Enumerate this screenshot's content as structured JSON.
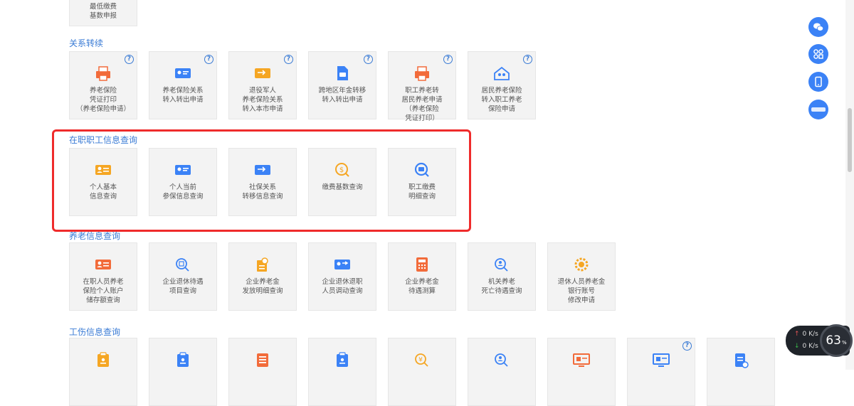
{
  "top_partial": {
    "label": "最低缴费\n基数申报"
  },
  "sections": [
    {
      "title": "关系转续",
      "items": [
        {
          "label": "养老保险\n凭证打印\n（养老保险申请）",
          "icon": "printer-icon",
          "help": true,
          "color": "#f26b3a"
        },
        {
          "label": "养老保险关系\n转入转出申请",
          "icon": "id-card-icon",
          "help": true,
          "color": "#3b82f6"
        },
        {
          "label": "退役军人\n养老保险关系\n转入本市申请",
          "icon": "transfer-card-icon",
          "help": true,
          "color": "#f5a623"
        },
        {
          "label": "跨地区年金转移\n转入转出申请",
          "icon": "document-icon",
          "help": true,
          "color": "#3b82f6"
        },
        {
          "label": "职工养老转\n居民养老申请\n（养老保险\n凭证打印）",
          "icon": "printer-icon",
          "help": true,
          "color": "#f26b3a"
        },
        {
          "label": "居民养老保险\n转入职工养老\n保险申请",
          "icon": "house-people-icon",
          "help": true,
          "color": "#3b82f6"
        }
      ]
    },
    {
      "title": "在职职工信息查询",
      "items": [
        {
          "label": "个人基本\n信息查询",
          "icon": "person-card-icon",
          "help": false,
          "color": "#f5a623"
        },
        {
          "label": "个人当前\n参保信息查询",
          "icon": "id-card-icon",
          "help": false,
          "color": "#3b82f6"
        },
        {
          "label": "社保关系\n转移信息查询",
          "icon": "transfer-card-icon",
          "help": false,
          "color": "#3b82f6"
        },
        {
          "label": "缴费基数查询",
          "icon": "coin-search-icon",
          "help": false,
          "color": "#f5a623"
        },
        {
          "label": "职工缴费\n明细查询",
          "icon": "magnifier-card-icon",
          "help": false,
          "color": "#3b82f6"
        }
      ]
    },
    {
      "title": "养老信息查询",
      "items": [
        {
          "label": "在职人员养老\n保险个人账户\n储存额查询",
          "icon": "person-card-icon",
          "help": false,
          "color": "#f26b3a"
        },
        {
          "label": "企业退休待遇\n项目查询",
          "icon": "search-doc-icon",
          "help": false,
          "color": "#3b82f6"
        },
        {
          "label": "企业养老金\n发放明细查询",
          "icon": "coin-doc-icon",
          "help": false,
          "color": "#f5a623"
        },
        {
          "label": "企业退休退职\n人员调动查询",
          "icon": "transfer-people-icon",
          "help": false,
          "color": "#3b82f6"
        },
        {
          "label": "企业养老金\n待遇测算",
          "icon": "calculator-icon",
          "help": false,
          "color": "#f26b3a"
        },
        {
          "label": "机关养老\n死亡待遇查询",
          "icon": "search-person-icon",
          "help": false,
          "color": "#3b82f6"
        },
        {
          "label": "退休人员养老金\n银行账号\n修改申请",
          "icon": "gear-coin-icon",
          "help": false,
          "color": "#f5a623"
        }
      ]
    },
    {
      "title": "工伤信息查询",
      "items": [
        {
          "label": "",
          "icon": "clipboard-person-icon",
          "help": false,
          "color": "#f5a623"
        },
        {
          "label": "",
          "icon": "clipboard-person-icon",
          "help": false,
          "color": "#3b82f6"
        },
        {
          "label": "",
          "icon": "list-doc-icon",
          "help": false,
          "color": "#f26b3a"
        },
        {
          "label": "",
          "icon": "clipboard-person-icon",
          "help": false,
          "color": "#3b82f6"
        },
        {
          "label": "",
          "icon": "search-coin-icon",
          "help": false,
          "color": "#f5a623"
        },
        {
          "label": "",
          "icon": "search-person-icon",
          "help": false,
          "color": "#3b82f6"
        },
        {
          "label": "",
          "icon": "monitor-icon",
          "help": false,
          "color": "#f26b3a"
        },
        {
          "label": "",
          "icon": "monitor-icon",
          "help": true,
          "color": "#3b82f6"
        },
        {
          "label": "",
          "icon": "doc-lock-icon",
          "help": false,
          "color": "#3b82f6"
        }
      ]
    }
  ],
  "help_glyph": "?",
  "side_buttons": [
    {
      "icon": "wechat-icon"
    },
    {
      "icon": "app-grid-icon"
    },
    {
      "icon": "mobile-phone-icon"
    },
    {
      "icon": "service-hall-icon"
    }
  ],
  "net_widget": {
    "up": "0 K/s",
    "down": "0 K/s",
    "percent": "63",
    "percent_unit": "%"
  }
}
